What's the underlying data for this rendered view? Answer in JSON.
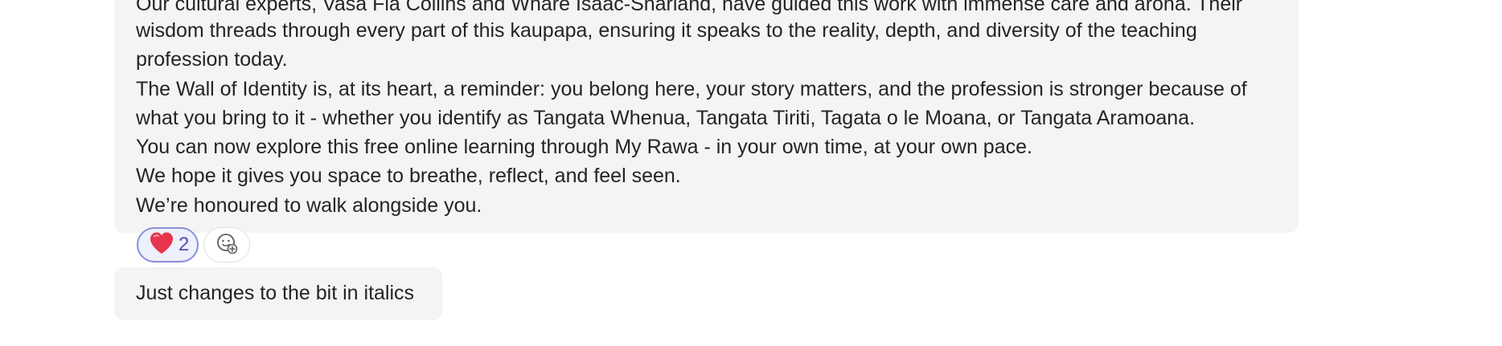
{
  "message": {
    "lines": [
      "Our cultural experts, Vasa Fia Collins and Whare Isaac-Sharland, have guided this work with immense care and aroha. Their",
      "wisdom threads through every part of this kaupapa, ensuring it speaks to the reality, depth, and diversity of the teaching",
      "profession today.",
      "The Wall of Identity is, at its heart, a reminder: you belong here, your story matters, and the profession is stronger because of",
      "what you bring to it - whether you identify as Tangata Whenua, Tangata Tiriti, Tagata o le Moana, or Tangata Aramoana.",
      "You can now explore this free online learning through My Rawa - in your own time, at your own pace.",
      "We hope it gives you space to breathe, reflect, and feel seen.",
      "We’re honoured to walk alongside you."
    ]
  },
  "reactions": {
    "heart": {
      "icon": "heart-icon",
      "count": "2",
      "color": "#e8344d"
    },
    "add": {
      "icon": "add-reaction-icon"
    }
  },
  "reply": {
    "text": "Just changes to the bit in italics"
  },
  "colors": {
    "bubble_bg": "#f4f4f4",
    "text": "#242424",
    "reaction_border": "#8b8fd8",
    "reaction_count": "#4f52b2"
  }
}
